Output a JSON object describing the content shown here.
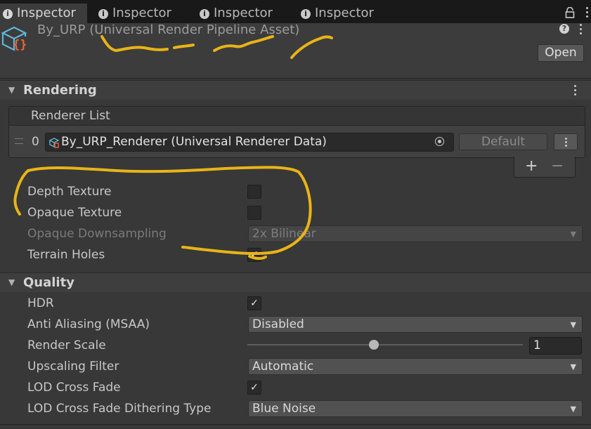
{
  "tabs": [
    {
      "label": "Inspector",
      "active": true
    },
    {
      "label": "Inspector",
      "active": false
    },
    {
      "label": "Inspector",
      "active": false
    },
    {
      "label": "Inspector",
      "active": false
    }
  ],
  "header": {
    "asset_title": "By_URP (Universal Render Pipeline Asset)",
    "open_button": "Open",
    "help_glyph": "?"
  },
  "rendering": {
    "title": "Rendering",
    "renderer_list": {
      "header": "Renderer List",
      "rows": [
        {
          "index": "0",
          "value": "By_URP_Renderer (Universal Renderer Data)",
          "default_label": "Default"
        }
      ],
      "add_glyph": "+",
      "remove_glyph": "−"
    },
    "fields": {
      "depth_texture": {
        "label": "Depth Texture",
        "checked": false
      },
      "opaque_texture": {
        "label": "Opaque Texture",
        "checked": false
      },
      "opaque_downsampling": {
        "label": "Opaque Downsampling",
        "value": "2x Bilinear",
        "disabled": true
      },
      "terrain_holes": {
        "label": "Terrain Holes",
        "checked": true
      }
    }
  },
  "quality": {
    "title": "Quality",
    "hdr": {
      "label": "HDR",
      "checked": true
    },
    "anti_aliasing": {
      "label": "Anti Aliasing (MSAA)",
      "value": "Disabled"
    },
    "render_scale": {
      "label": "Render Scale",
      "value": "1",
      "slider_fraction": 0.46
    },
    "upscaling_filter": {
      "label": "Upscaling Filter",
      "value": "Automatic"
    },
    "lod_cross_fade": {
      "label": "LOD Cross Fade",
      "checked": true
    },
    "lod_dither": {
      "label": "LOD Cross Fade Dithering Type",
      "value": "Blue Noise"
    }
  },
  "colors": {
    "annotation": "#e8b417",
    "panel_bg": "#383838",
    "icon_blue": "#5fb6d8",
    "icon_orange": "#f0623a"
  },
  "icons": {
    "tab": "info-icon",
    "lock": "lock-icon",
    "asset": "urp-asset-icon",
    "menu": "kebab-menu-icon",
    "target": "object-picker-icon"
  }
}
